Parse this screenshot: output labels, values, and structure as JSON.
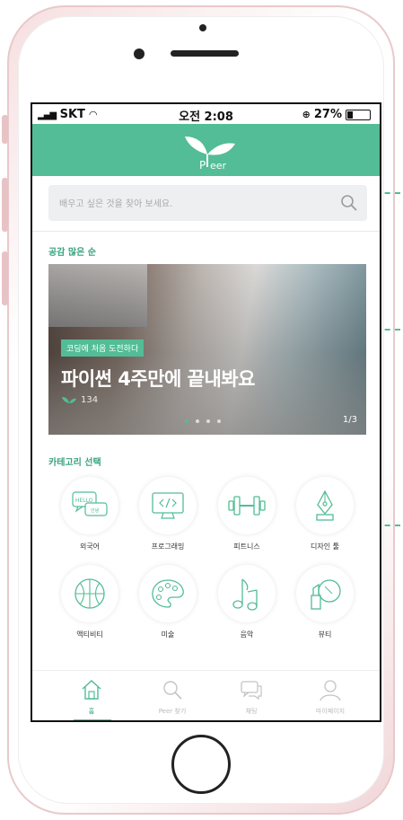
{
  "status_bar": {
    "carrier": "SKT",
    "time": "오전 2:08",
    "battery": "27%"
  },
  "header": {
    "logo_text": "eer",
    "logo_initial": "P"
  },
  "search": {
    "placeholder": "배우고 싶은 것을 찾아 보세요."
  },
  "popular": {
    "title": "공감 많은 순",
    "banner": {
      "tag": "코딩에 처음 도전하다",
      "title": "파이썬 4주만에 끝내봐요",
      "likes": "134",
      "page": "1/3",
      "dots": 4,
      "active_dot": 0
    }
  },
  "categories": {
    "title": "카테고리 선택",
    "items": [
      {
        "label": "외국어",
        "icon": "speech-bubbles-icon"
      },
      {
        "label": "프로그래밍",
        "icon": "monitor-code-icon"
      },
      {
        "label": "피트니스",
        "icon": "dumbbell-icon"
      },
      {
        "label": "디자인 툴",
        "icon": "pen-nib-icon"
      },
      {
        "label": "액티비티",
        "icon": "ball-icon"
      },
      {
        "label": "미술",
        "icon": "palette-icon"
      },
      {
        "label": "음악",
        "icon": "music-notes-icon"
      },
      {
        "label": "뷰티",
        "icon": "lipstick-mirror-icon"
      }
    ]
  },
  "tabbar": {
    "items": [
      {
        "label": "홈",
        "icon": "home-icon",
        "active": true
      },
      {
        "label": "Peer 찾기",
        "icon": "search-icon",
        "active": false
      },
      {
        "label": "채팅",
        "icon": "chat-icon",
        "active": false
      },
      {
        "label": "마이페이지",
        "icon": "user-icon",
        "active": false
      }
    ]
  },
  "colors": {
    "accent": "#52bd96",
    "accent_dark": "#3aa37d"
  }
}
